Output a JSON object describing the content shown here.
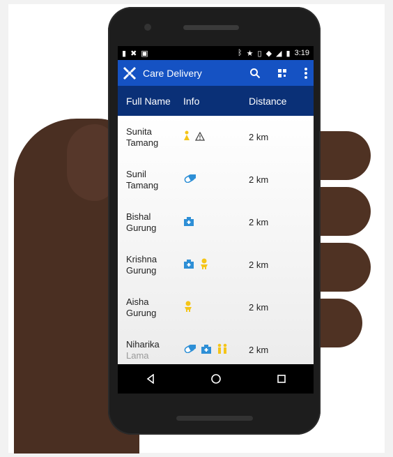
{
  "status": {
    "time": "3:19"
  },
  "app": {
    "title": "Care Delivery"
  },
  "columns": [
    "Full Name",
    "Info",
    "Distance"
  ],
  "rows": [
    {
      "first": "Sunita",
      "last": "Tamang",
      "icons": [
        "female-icon",
        "warning-icon"
      ],
      "distance": "2 km"
    },
    {
      "first": "Sunil",
      "last": "Tamang",
      "icons": [
        "pill-icon"
      ],
      "distance": "2 km"
    },
    {
      "first": "Bishal",
      "last": "Gurung",
      "icons": [
        "hospital-icon"
      ],
      "distance": "2 km"
    },
    {
      "first": "Krishna",
      "last": "Gurung",
      "icons": [
        "hospital-icon",
        "child-icon"
      ],
      "distance": "2 km"
    },
    {
      "first": "Aisha",
      "last": "Gurung",
      "icons": [
        "child-icon"
      ],
      "distance": "2 km"
    },
    {
      "first": "Niharika",
      "last": "Lama",
      "icons": [
        "pill-icon",
        "hospital-icon",
        "family-icon"
      ],
      "distance": "2 km"
    }
  ],
  "colors": {
    "appbar": "#1552c3",
    "header": "#0a3077",
    "icon_yellow": "#f5c518",
    "icon_blue": "#2e8fd6"
  }
}
